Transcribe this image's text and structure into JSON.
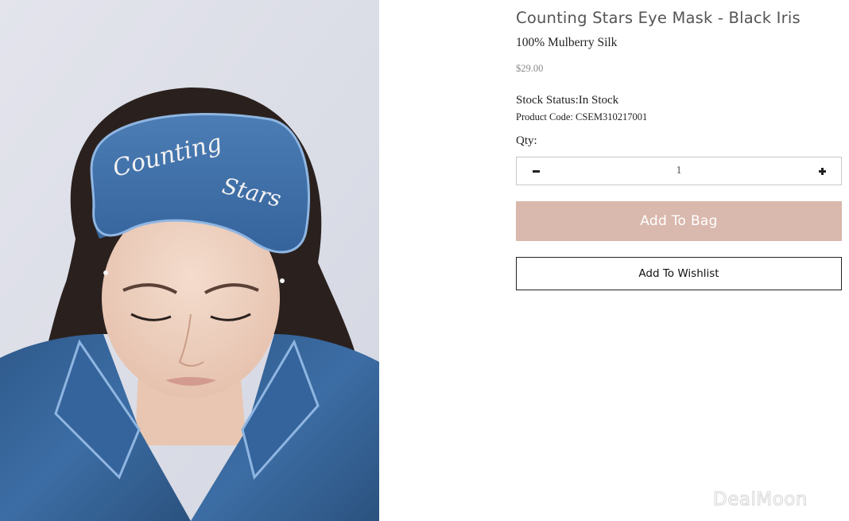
{
  "product": {
    "title": "Counting Stars Eye Mask - Black Iris",
    "subtitle": "100% Mulberry Silk",
    "price": "$29.00",
    "stock_status": "Stock Status:In Stock",
    "product_code": "Product Code: CSEM310217001",
    "image": {
      "mask_text_line1": "Counting",
      "mask_text_line2": "Stars"
    }
  },
  "quantity": {
    "label": "Qty:",
    "value": "1"
  },
  "actions": {
    "add_to_bag": "Add To Bag",
    "add_to_wishlist": "Add To Wishlist"
  },
  "watermark": "DealMoon",
  "colors": {
    "add_to_bag_bg": "#d9b8ad",
    "title_text": "#555555",
    "price_text": "#8a8a8a",
    "mask_blue": "#3f6ea6",
    "background_image": "#dde0ea"
  },
  "icons": {
    "qty_decrease": "minus-icon",
    "qty_increase": "plus-icon"
  }
}
